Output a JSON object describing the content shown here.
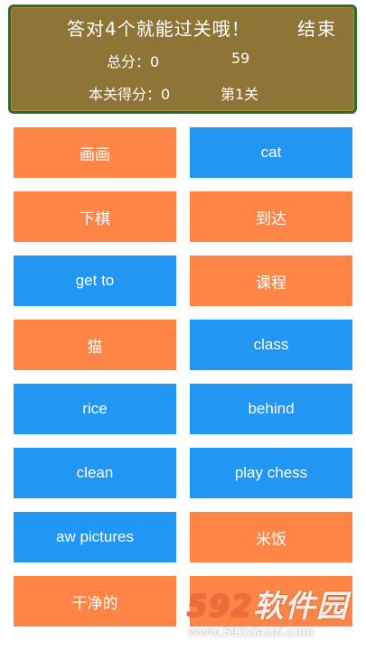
{
  "header": {
    "prompt": "答对4个就能过关哦！",
    "end_label": "结束",
    "total_score": "总分：0",
    "timer": "59",
    "level_score": "本关得分：0",
    "level": "第1关"
  },
  "colors": {
    "header_bg": "#8e7537",
    "header_border": "#2f6b22",
    "card_orange": "#ff8547",
    "card_blue": "#2196f3"
  },
  "cards": [
    {
      "label": "画画",
      "color": "orange"
    },
    {
      "label": "cat",
      "color": "blue"
    },
    {
      "label": "下棋",
      "color": "orange"
    },
    {
      "label": "到达",
      "color": "orange"
    },
    {
      "label": "get to",
      "color": "blue"
    },
    {
      "label": "课程",
      "color": "orange"
    },
    {
      "label": "猫",
      "color": "orange"
    },
    {
      "label": "class",
      "color": "blue"
    },
    {
      "label": "rice",
      "color": "blue"
    },
    {
      "label": "behind",
      "color": "blue"
    },
    {
      "label": "clean",
      "color": "blue"
    },
    {
      "label": "play chess",
      "color": "blue"
    },
    {
      "label": "aw pictures",
      "color": "blue"
    },
    {
      "label": "米饭",
      "color": "orange"
    },
    {
      "label": "干净的",
      "color": "orange"
    },
    {
      "label": "",
      "color": "orange"
    }
  ],
  "watermark": {
    "main_num": "592",
    "main_text": "软件园",
    "sub": "www.592xiazai.com"
  }
}
